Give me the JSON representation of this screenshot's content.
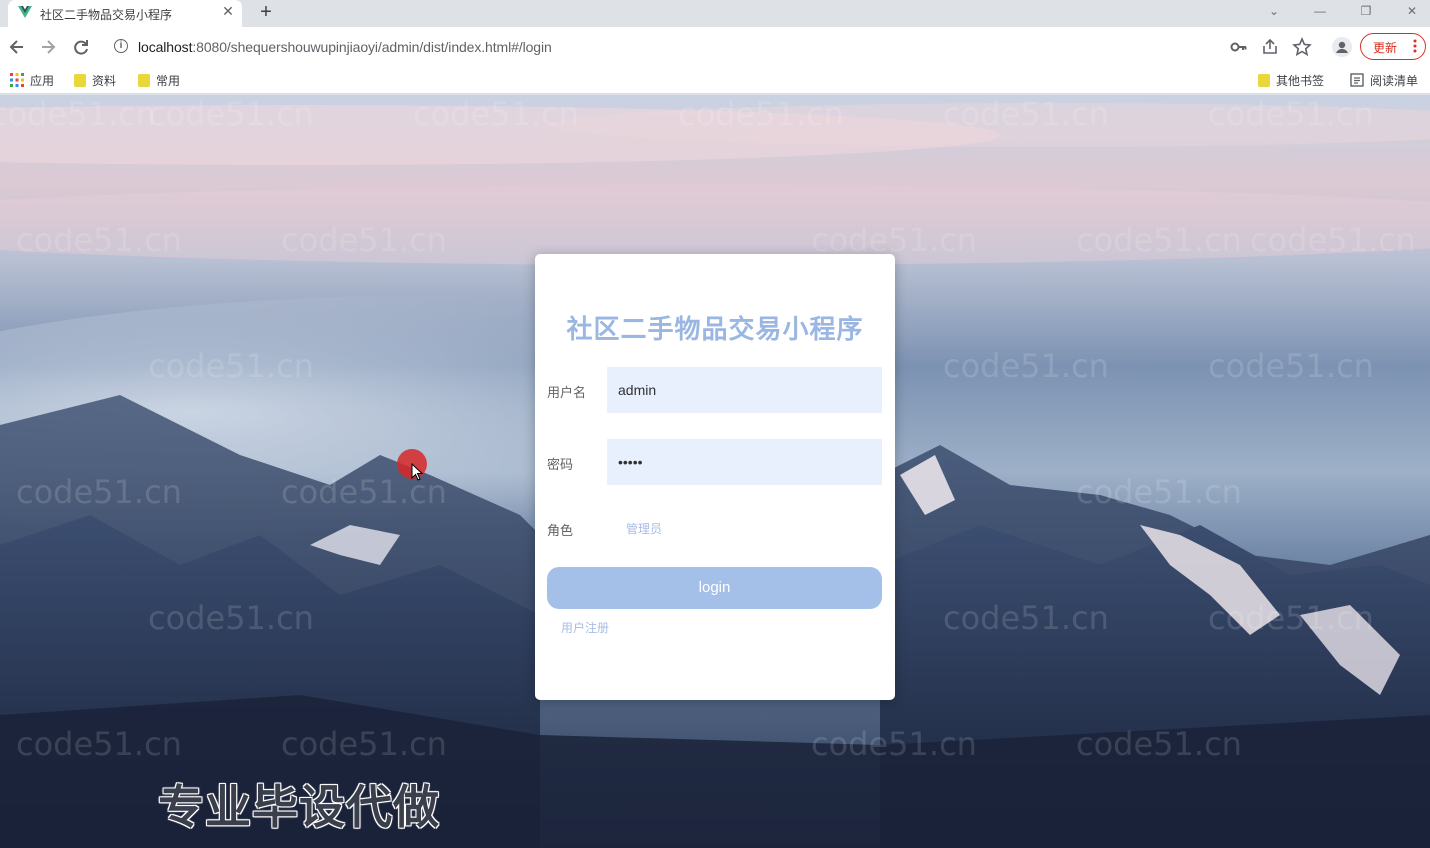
{
  "browser": {
    "tab_title": "社区二手物品交易小程序",
    "url_host": "localhost",
    "url_rest": ":8080/shequershouwupinjiaoyi/admin/dist/index.html#/login",
    "update_label": "更新"
  },
  "bookmarks": {
    "apps": "应用",
    "items": [
      "资料",
      "常用"
    ],
    "other": "其他书签",
    "reading_list": "阅读清单"
  },
  "watermark": "code51.cn",
  "login": {
    "title": "社区二手物品交易小程序",
    "username_label": "用户名",
    "username_value": "admin",
    "password_label": "密码",
    "password_value": "•••••",
    "role_label": "角色",
    "role_option": "管理员",
    "login_button": "login",
    "register_link": "用户注册"
  },
  "banner": "专业毕设代做",
  "colors": {
    "accent": "#a4bfe8",
    "title": "#9ab6e2",
    "field_bg": "#e8f0fe",
    "update": "#d93025"
  }
}
